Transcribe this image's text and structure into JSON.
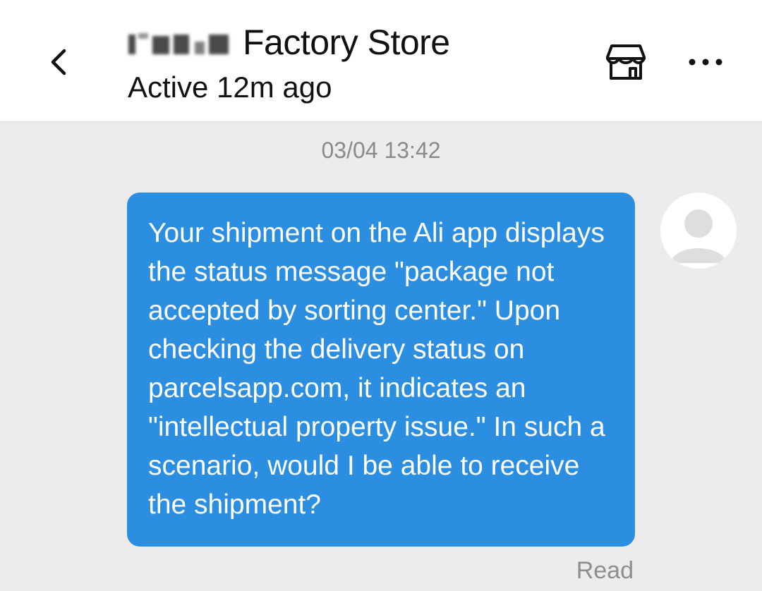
{
  "header": {
    "store_name": "Factory Store",
    "status": "Active 12m ago"
  },
  "icons": {
    "back": "chevron-left-icon",
    "store": "storefront-icon",
    "more": "more-horizontal-icon"
  },
  "chat": {
    "timestamp": "03/04 13:42",
    "message": "Your shipment on the Ali app displays the status message \"package not accepted by sorting center.\" Upon checking the delivery status on parcelsapp.com, it indicates an \"intellectual property issue.\" In such a scenario, would I be able to receive the shipment?",
    "read_label": "Read"
  },
  "colors": {
    "bubble": "#2b8ee0",
    "background": "#ececec",
    "header": "#ffffff"
  }
}
